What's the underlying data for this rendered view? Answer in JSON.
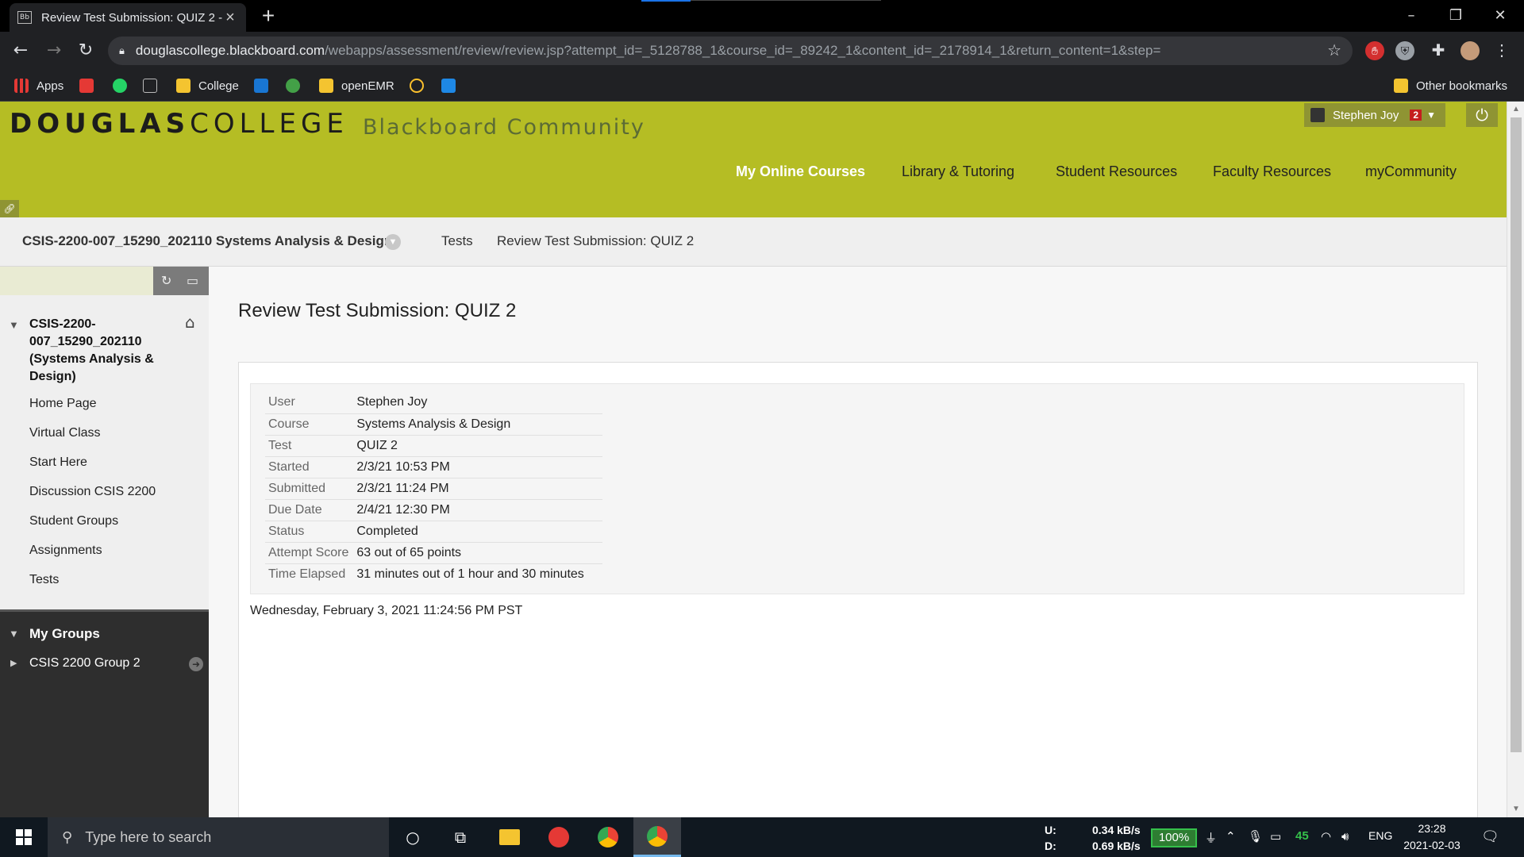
{
  "browser": {
    "tab_title": "Review Test Submission: QUIZ 2 -",
    "tab_favicon": "Bb",
    "url_host": "douglascollege.blackboard.com",
    "url_path": "/webapps/assessment/review/review.jsp?attempt_id=_5128788_1&course_id=_89242_1&content_id=_2178914_1&return_content=1&step=",
    "icons": [
      "back-icon",
      "forward-icon",
      "reload-icon",
      "lock-icon",
      "star-icon",
      "extensions-icon",
      "menu-icon"
    ]
  },
  "bookmarks": {
    "apps": "Apps",
    "college": "College",
    "openemr": "openEMR",
    "other": "Other bookmarks",
    "bb_label": "Bb"
  },
  "header": {
    "logo_bold": "DOUGLAS",
    "logo_regular": "COLLEGE",
    "site_name": "Blackboard Community",
    "user_name": "Stephen Joy",
    "notification_count": "2",
    "brand_color": "#b5bd24",
    "nav": [
      {
        "label": "My Online Courses",
        "active": true
      },
      {
        "label": "Library & Tutoring",
        "active": false
      },
      {
        "label": "Student Resources",
        "active": false
      },
      {
        "label": "Faculty Resources",
        "active": false
      },
      {
        "label": "myCommunity",
        "active": false
      }
    ]
  },
  "breadcrumbs": {
    "course": "CSIS-2200-007_15290_202110 Systems Analysis & Design",
    "tests": "Tests",
    "current": "Review Test Submission: QUIZ 2"
  },
  "course_menu": {
    "title": "CSIS-2200-007_15290_202110 (Systems Analysis & Design)",
    "items": [
      "Home Page",
      "Virtual Class",
      "Start Here",
      "Discussion CSIS 2200",
      "Student Groups",
      "Assignments",
      "Tests"
    ]
  },
  "groups": {
    "title": "My Groups",
    "items": [
      "CSIS 2200 Group 2"
    ]
  },
  "content": {
    "page_title": "Review Test Submission: QUIZ 2",
    "details": [
      {
        "label": "User",
        "value": "Stephen Joy"
      },
      {
        "label": "Course",
        "value": "Systems Analysis & Design"
      },
      {
        "label": "Test",
        "value": "QUIZ 2"
      },
      {
        "label": "Started",
        "value": "2/3/21 10:53 PM"
      },
      {
        "label": "Submitted",
        "value": "2/3/21 11:24 PM"
      },
      {
        "label": "Due Date",
        "value": "2/4/21 12:30 PM"
      },
      {
        "label": "Status",
        "value": "Completed"
      },
      {
        "label": "Attempt Score",
        "value": "63 out of 65 points"
      },
      {
        "label": "Time Elapsed",
        "value": "31 minutes out of 1 hour and 30 minutes"
      }
    ],
    "timestamp": "Wednesday, February 3, 2021 11:24:56 PM PST"
  },
  "taskbar": {
    "search_placeholder": "Type here to search",
    "upload_label": "U:",
    "download_label": "D:",
    "upload_speed": "0.34 kB/s",
    "download_speed": "0.69 kB/s",
    "battery_percent": "100%",
    "tray_number": "45",
    "language": "ENG",
    "time": "23:28",
    "date": "2021-02-03"
  }
}
